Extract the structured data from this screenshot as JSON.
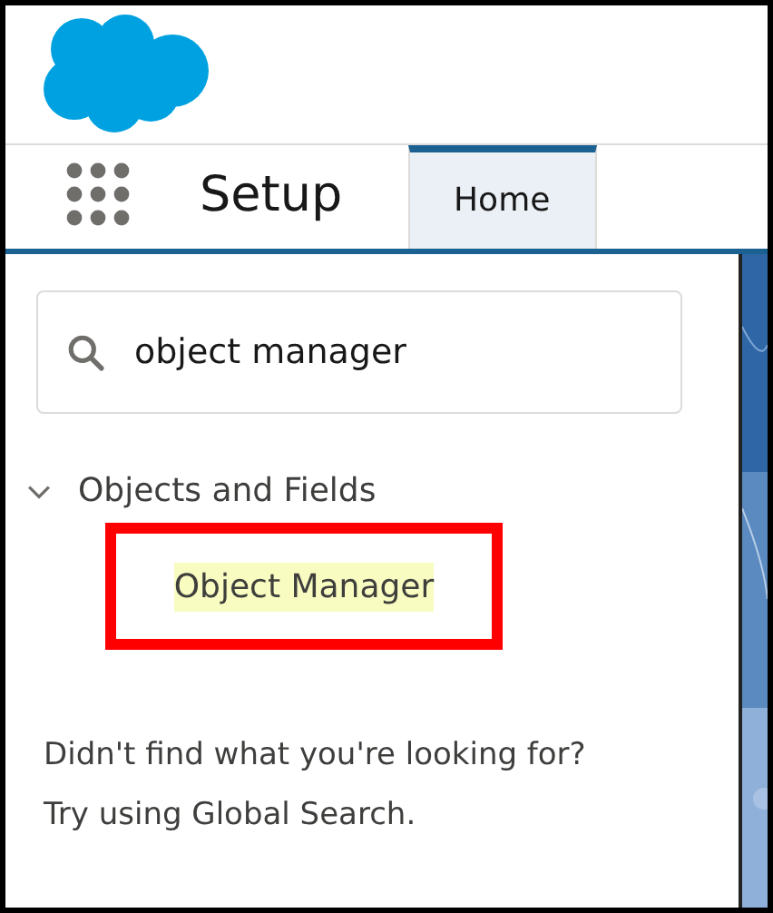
{
  "nav": {
    "app_title": "Setup",
    "tabs": [
      {
        "label": "Home",
        "selected": true
      }
    ]
  },
  "search": {
    "value": "object manager"
  },
  "tree": [
    {
      "label": "Objects and Fields",
      "expanded": true,
      "children": [
        {
          "label": "Object Manager",
          "highlighted": true,
          "annotated": true
        }
      ]
    }
  ],
  "message": [
    "Didn't find what you're looking for?",
    "Try using Global Search."
  ]
}
